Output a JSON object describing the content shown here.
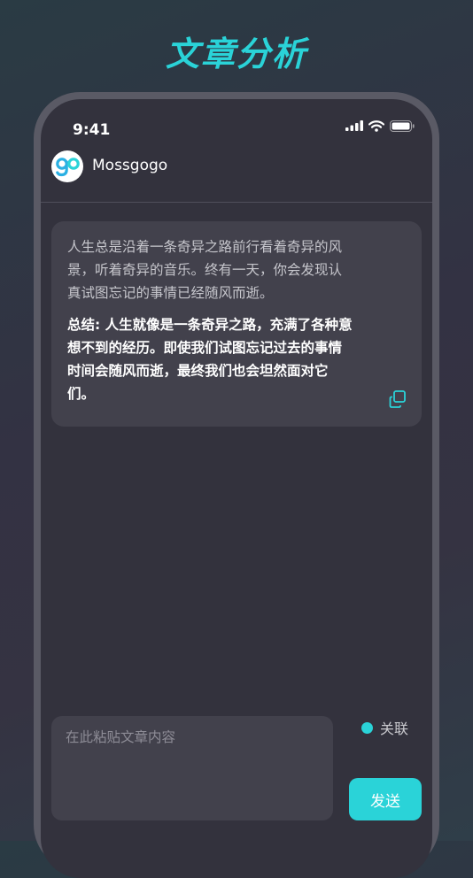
{
  "page": {
    "heading": "文章分析",
    "accent_color": "#2ad3d8"
  },
  "status_bar": {
    "time": "9:41",
    "icons": [
      "signal-icon",
      "wifi-icon",
      "battery-icon"
    ]
  },
  "app_header": {
    "logo_text": "go",
    "app_name": "Mossgogo"
  },
  "result_card": {
    "original_text": "人生总是沿着一条奇异之路前行看着奇异的风景，听着奇异的音乐。终有一天，你会发现认真试图忘记的事情已经随风而逝。",
    "summary_text": "总结: 人生就像是一条奇异之路，充满了各种意想不到的经历。即使我们试图忘记过去的事情时间会随风而逝，最终我们也会坦然面对它们。",
    "copy_icon": "copy-icon"
  },
  "composer": {
    "placeholder": "在此粘贴文章内容",
    "value": "",
    "relate_label": "关联",
    "relate_enabled": true,
    "send_label": "发送"
  }
}
